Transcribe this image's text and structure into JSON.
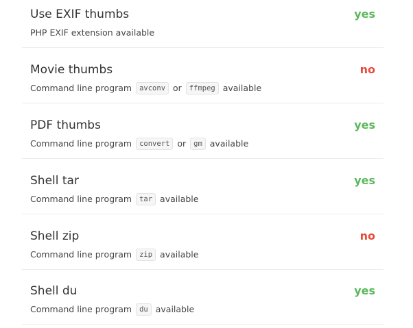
{
  "features": [
    {
      "title": "Use EXIF thumbs",
      "status": "yes",
      "description": "PHP EXIF extension available"
    },
    {
      "title": "Movie thumbs",
      "status": "no",
      "prefix": "Command line program",
      "program1": "avconv",
      "connector": "or",
      "program2": "ffmpeg",
      "suffix": "available"
    },
    {
      "title": "PDF thumbs",
      "status": "yes",
      "prefix": "Command line program",
      "program1": "convert",
      "connector": "or",
      "program2": "gm",
      "suffix": "available"
    },
    {
      "title": "Shell tar",
      "status": "yes",
      "prefix": "Command line program",
      "program1": "tar",
      "suffix": "available"
    },
    {
      "title": "Shell zip",
      "status": "no",
      "prefix": "Command line program",
      "program1": "zip",
      "suffix": "available"
    },
    {
      "title": "Shell du",
      "status": "yes",
      "prefix": "Command line program",
      "program1": "du",
      "suffix": "available"
    }
  ],
  "colors": {
    "yes": "#5cb85c",
    "no": "#e74c3c",
    "text": "#333333",
    "divider": "#ececec"
  }
}
